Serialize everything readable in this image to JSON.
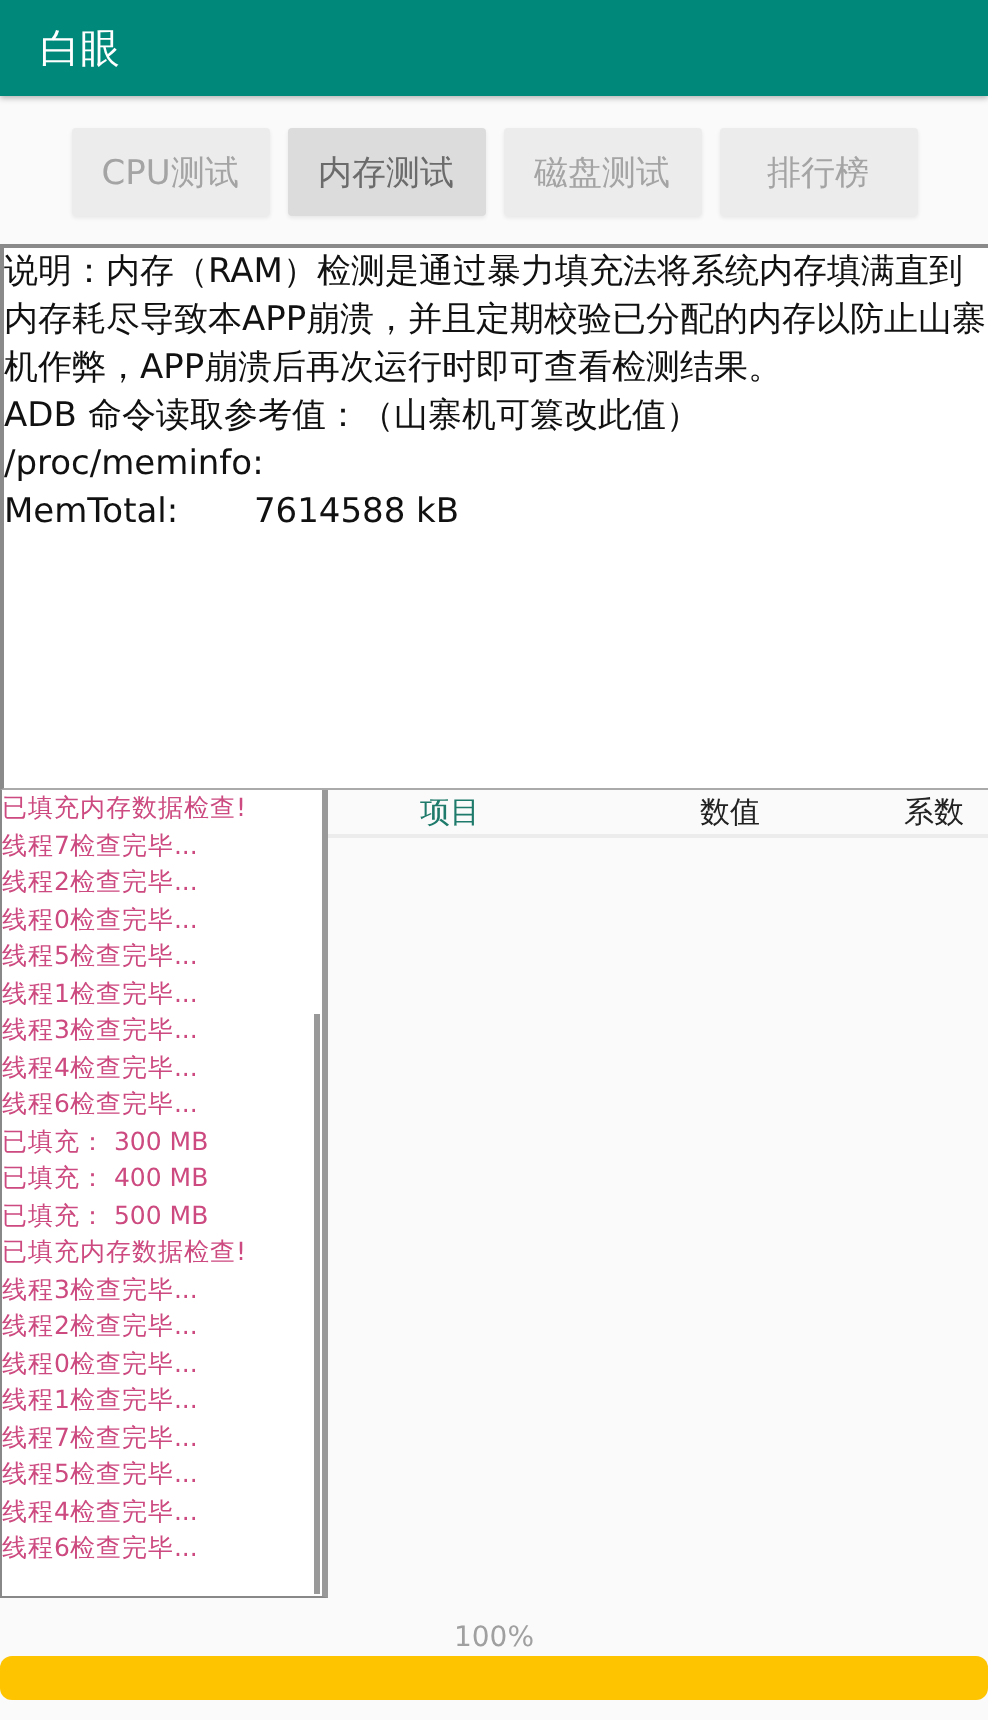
{
  "app_bar": {
    "title": "白眼"
  },
  "tabs": [
    {
      "label": "CPU测试",
      "selected": false
    },
    {
      "label": "内存测试",
      "selected": true
    },
    {
      "label": "磁盘测试",
      "selected": false
    },
    {
      "label": "排行榜",
      "selected": false
    }
  ],
  "description": [
    "说明：内存（RAM）检测是通过暴力填充法将系统内存填满直到内存耗尽导致本APP崩溃，并且定期校验已分配的内存以防止山寨机作弊，APP崩溃后再次运行时即可查看检测结果。",
    "ADB 命令读取参考值：（山寨机可篡改此值）",
    "/proc/meminfo:",
    "MemTotal:       7614588 kB"
  ],
  "log": [
    "已填充内存数据检查!",
    "线程7检查完毕...",
    "线程2检查完毕...",
    "线程0检查完毕...",
    "线程5检查完毕...",
    "线程1检查完毕...",
    "线程3检查完毕...",
    "线程4检查完毕...",
    "线程6检查完毕...",
    "已填充：  300 MB",
    "已填充：  400 MB",
    "已填充：  500 MB",
    "已填充内存数据检查!",
    "线程3检查完毕...",
    "线程2检查完毕...",
    "线程0检查完毕...",
    "线程1检查完毕...",
    "线程7检查完毕...",
    "线程5检查完毕...",
    "线程4检查完毕...",
    "线程6检查完毕..."
  ],
  "table": {
    "columns": [
      {
        "label": "项目",
        "kind": "accent"
      },
      {
        "label": "数值",
        "kind": "plain"
      },
      {
        "label": "系数",
        "kind": "plain"
      }
    ]
  },
  "progress": {
    "reading": "100%",
    "level": 1
  }
}
